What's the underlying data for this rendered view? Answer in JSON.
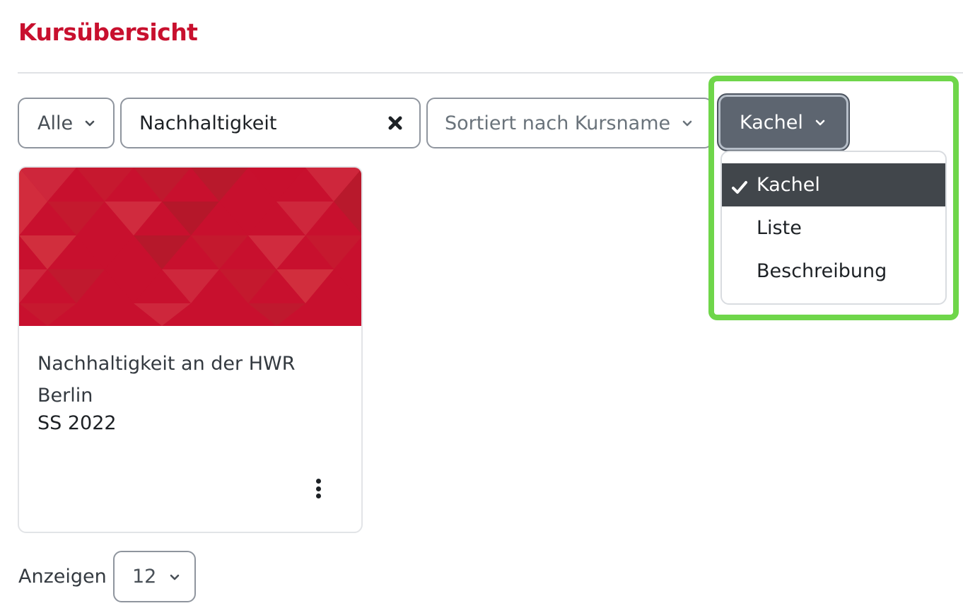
{
  "header": {
    "title": "Kursübersicht"
  },
  "filters": {
    "grouping": {
      "label": "Alle",
      "icon": "chevron-down-icon"
    },
    "search": {
      "value": "Nachhaltigkeit",
      "clear_icon": "close-icon"
    },
    "sort": {
      "label": "Sortiert nach Kursname",
      "icon": "chevron-down-icon"
    },
    "view": {
      "label": "Kachel",
      "icon": "chevron-down-icon"
    }
  },
  "view_menu": {
    "items": [
      {
        "label": "Kachel",
        "selected": true
      },
      {
        "label": "Liste",
        "selected": false
      },
      {
        "label": "Beschreibung",
        "selected": false
      }
    ],
    "check_icon": "check-icon"
  },
  "courses": [
    {
      "title": "Nachhaltigkeit an der HWR Berlin",
      "term": "SS 2022",
      "menu_icon": "kebab-menu-icon",
      "image_color": "#c8102e"
    }
  ],
  "paging": {
    "label": "Anzeigen",
    "value": "12"
  },
  "colors": {
    "brand": "#c8102e",
    "highlight": "#6fd64a",
    "view_button": "#5d6570",
    "menu_active": "#41464b"
  }
}
